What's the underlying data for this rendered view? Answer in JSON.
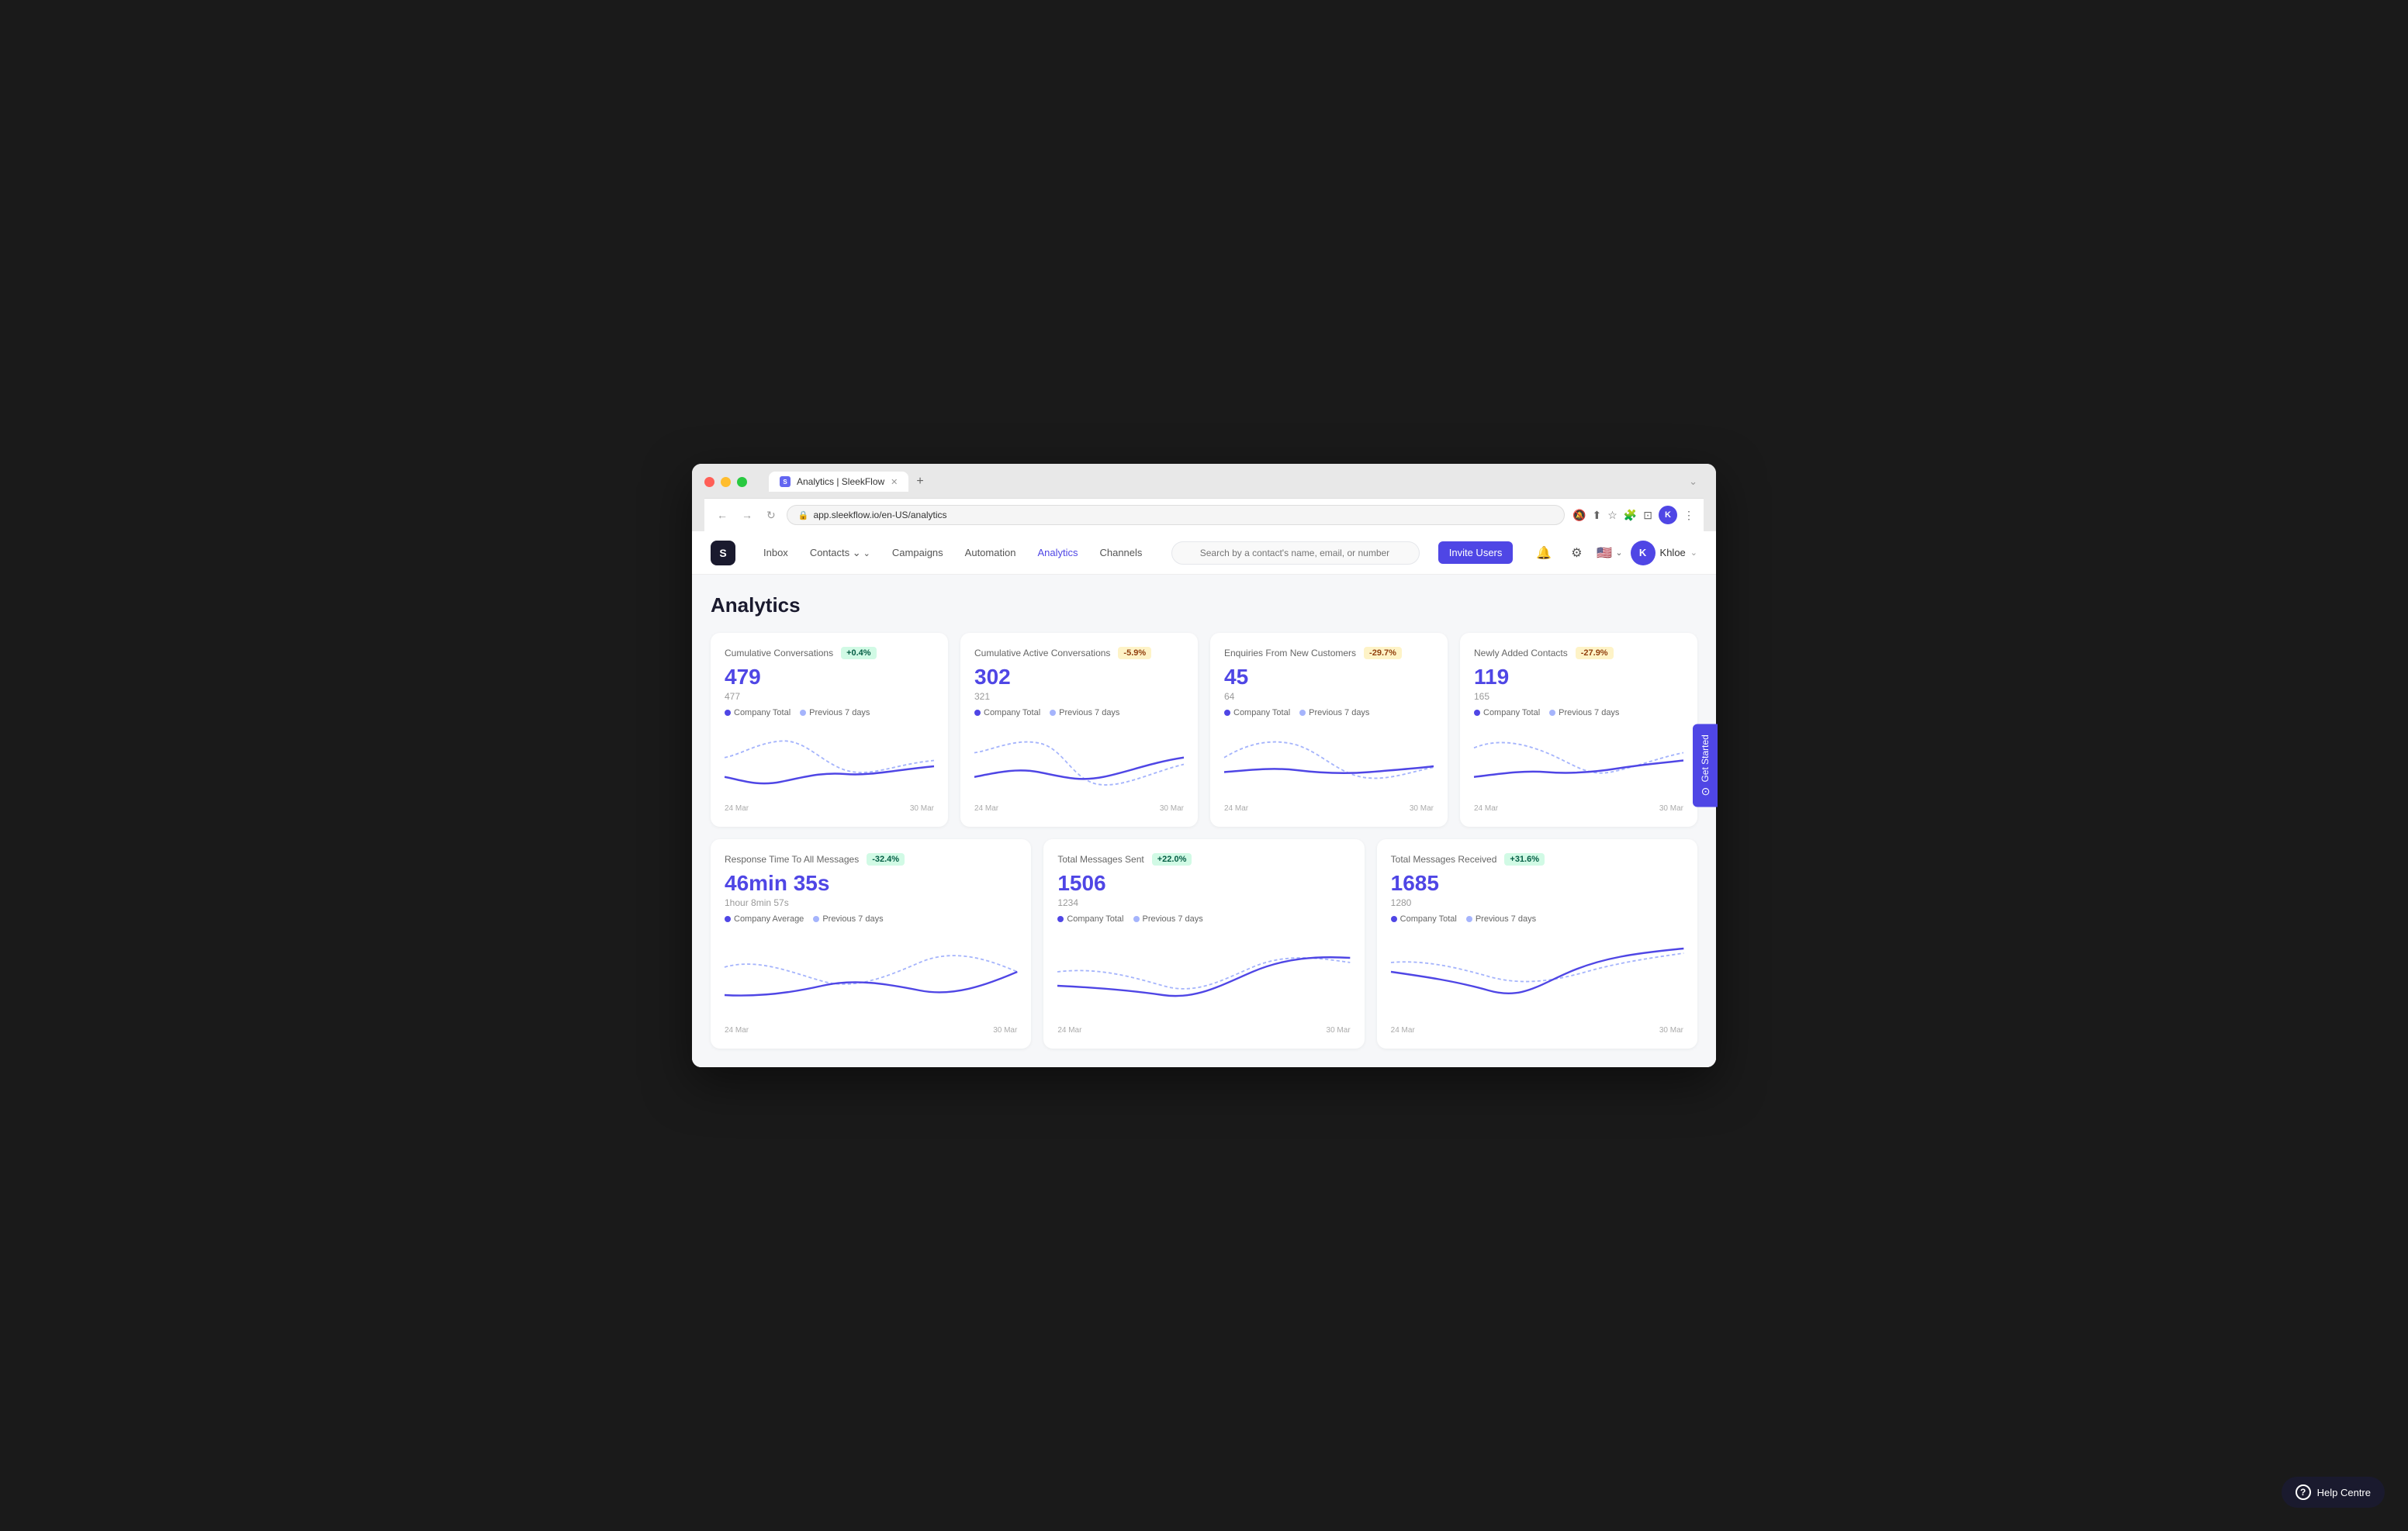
{
  "browser": {
    "url": "app.sleekflow.io/en-US/analytics",
    "tab_title": "Analytics | SleekFlow",
    "tab_favicon": "S",
    "new_tab": "+"
  },
  "nav": {
    "logo": "S",
    "items": [
      {
        "label": "Inbox",
        "active": false,
        "has_arrow": false
      },
      {
        "label": "Contacts",
        "active": false,
        "has_arrow": true
      },
      {
        "label": "Campaigns",
        "active": false,
        "has_arrow": false
      },
      {
        "label": "Automation",
        "active": false,
        "has_arrow": false
      },
      {
        "label": "Analytics",
        "active": true,
        "has_arrow": false
      },
      {
        "label": "Channels",
        "active": false,
        "has_arrow": false
      }
    ],
    "search_placeholder": "Search by a contact's name, email, or number",
    "invite_btn": "Invite Users",
    "user": "Khloe",
    "user_initial": "K"
  },
  "page": {
    "title": "Analytics"
  },
  "cards_top": [
    {
      "title": "Cumulative Conversations",
      "badge": "+0.4%",
      "badge_type": "green",
      "value": "479",
      "prev_value": "477",
      "legend1": "Company Total",
      "legend2": "Previous 7 days",
      "date_start": "24 Mar",
      "date_end": "30 Mar",
      "chart_id": "chart1"
    },
    {
      "title": "Cumulative Active Conversations",
      "badge": "-5.9%",
      "badge_type": "red",
      "value": "302",
      "prev_value": "321",
      "legend1": "Company Total",
      "legend2": "Previous 7 days",
      "date_start": "24 Mar",
      "date_end": "30 Mar",
      "chart_id": "chart2"
    },
    {
      "title": "Enquiries From New Customers",
      "badge": "-29.7%",
      "badge_type": "red",
      "value": "45",
      "prev_value": "64",
      "legend1": "Company Total",
      "legend2": "Previous 7 days",
      "date_start": "24 Mar",
      "date_end": "30 Mar",
      "chart_id": "chart3"
    },
    {
      "title": "Newly Added Contacts",
      "badge": "-27.9%",
      "badge_type": "red",
      "value": "119",
      "prev_value": "165",
      "legend1": "Company Total",
      "legend2": "Previous 7 days",
      "date_start": "24 Mar",
      "date_end": "30 Mar",
      "chart_id": "chart4"
    }
  ],
  "cards_bottom": [
    {
      "title": "Response Time To All Messages",
      "badge": "-32.4%",
      "badge_type": "green",
      "value": "46min 35s",
      "prev_value": "1hour 8min 57s",
      "legend1": "Company Average",
      "legend2": "Previous 7 days",
      "date_start": "24 Mar",
      "date_end": "30 Mar",
      "chart_id": "chart5"
    },
    {
      "title": "Total Messages Sent",
      "badge": "+22.0%",
      "badge_type": "green",
      "value": "1506",
      "prev_value": "1234",
      "legend1": "Company Total",
      "legend2": "Previous 7 days",
      "date_start": "24 Mar",
      "date_end": "30 Mar",
      "chart_id": "chart6"
    },
    {
      "title": "Total Messages Received",
      "badge": "+31.6%",
      "badge_type": "green",
      "value": "1685",
      "prev_value": "1280",
      "legend1": "Company Total",
      "legend2": "Previous 7 days",
      "date_start": "24 Mar",
      "date_end": "30 Mar",
      "chart_id": "chart7"
    }
  ],
  "side_tab": {
    "label": "Get Started",
    "icon": "⊙"
  },
  "help_centre": {
    "label": "Help Centre"
  },
  "colors": {
    "primary": "#4f46e5",
    "primary_light": "#a5b4fc",
    "badge_green_bg": "#d1fae5",
    "badge_green_text": "#065f46",
    "badge_yellow_bg": "#fef3c7",
    "badge_yellow_text": "#92400e"
  }
}
